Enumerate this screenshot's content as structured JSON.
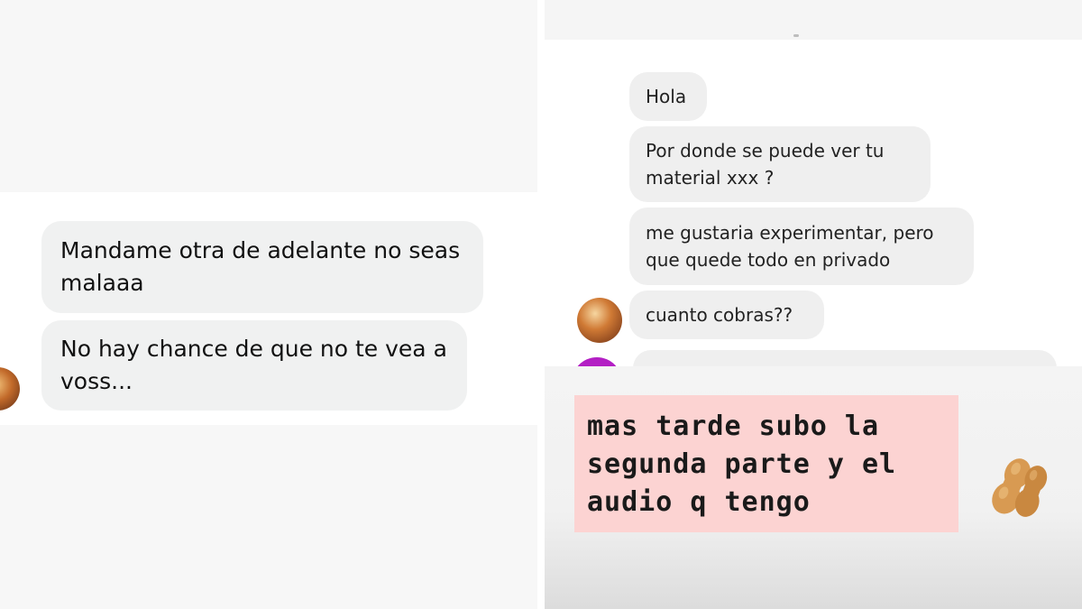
{
  "left": {
    "messages": [
      {
        "text": "Mandame otra de adelante no seas\nmalaaa"
      },
      {
        "text": "No hay chance de que no te vea a\nvoss..."
      }
    ]
  },
  "right": {
    "messages": [
      {
        "text": "Hola"
      },
      {
        "text": "Por donde se puede ver tu\nmaterial xxx ?"
      },
      {
        "text": "me gustaria experimentar, pero\nque quede todo en privado"
      },
      {
        "text": "cuanto cobras??"
      }
    ],
    "caption": "mas tarde subo la\nsegunda parte y el\naudio q tengo",
    "sticker_icon": "peanut-icon",
    "caption_bg": "#fcd3d2"
  }
}
